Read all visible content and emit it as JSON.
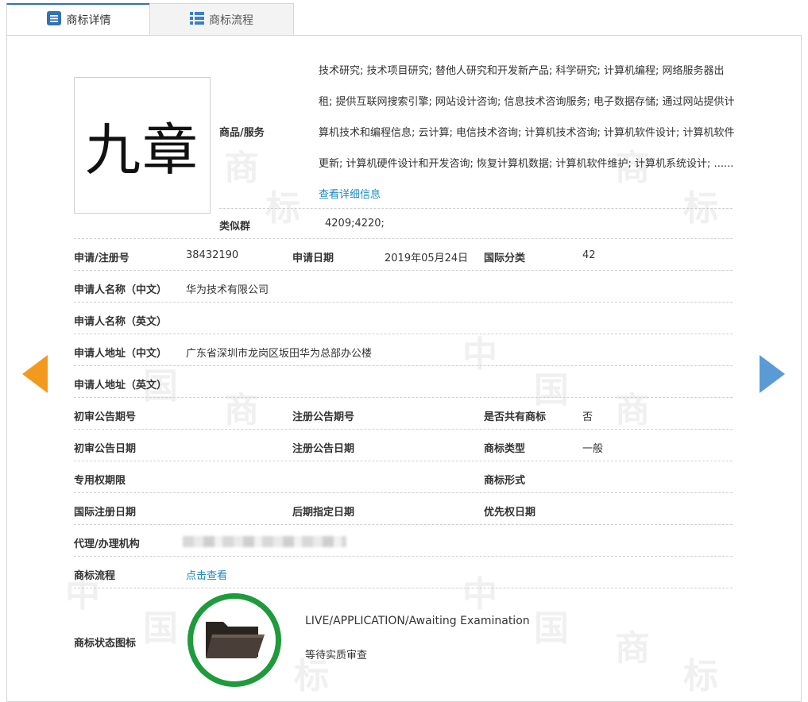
{
  "tabs": [
    {
      "label": "商标详情",
      "icon": "list-icon",
      "active": true
    },
    {
      "label": "商标流程",
      "icon": "grid-list-icon",
      "active": false
    }
  ],
  "trademark": {
    "logo_text": "九章",
    "goods_services_label": "商品/服务",
    "goods_services": "技术研究; 技术项目研究; 替他人研究和开发新产品; 科学研究; 计算机编程; 网络服务器出租; 提供互联网搜索引擎; 网站设计咨询; 信息技术咨询服务; 电子数据存储; 通过网站提供计算机技术和编程信息; 云计算; 电信技术咨询; 计算机技术咨询; 计算机软件设计; 计算机软件更新; 计算机硬件设计和开发咨询; 恢复计算机数据; 计算机软件维护; 计算机系统设计; ......",
    "more_link": "查看详细信息",
    "similar_group_label": "类似群",
    "similar_group": "4209;4220;"
  },
  "fields": {
    "reg_no_label": "申请/注册号",
    "reg_no": "38432190",
    "apply_date_label": "申请日期",
    "apply_date": "2019年05月24日",
    "intl_class_label": "国际分类",
    "intl_class": "42",
    "applicant_cn_label": "申请人名称（中文）",
    "applicant_cn": "华为技术有限公司",
    "applicant_en_label": "申请人名称（英文）",
    "address_cn_label": "申请人地址（中文）",
    "address_cn": "广东省深圳市龙岗区坂田华为总部办公楼",
    "address_en_label": "申请人地址（英文）",
    "prelim_no_label": "初审公告期号",
    "reg_pub_no_label": "注册公告期号",
    "shared_label": "是否共有商标",
    "shared": "否",
    "prelim_date_label": "初审公告日期",
    "reg_pub_date_label": "注册公告日期",
    "tm_type_label": "商标类型",
    "tm_type": "一般",
    "exclusive_term_label": "专用权期限",
    "tm_form_label": "商标形式",
    "intl_reg_date_label": "国际注册日期",
    "later_date_label": "后期指定日期",
    "priority_date_label": "优先权日期",
    "agent_label": "代理/办理机构",
    "flow_label": "商标流程",
    "flow_link": "点击查看",
    "status_icon_label": "商标状态图标",
    "status_en": "LIVE/APPLICATION/Awaiting Examination",
    "status_cn": "等待实质审查"
  },
  "watermark": [
    "中",
    "国",
    "商",
    "标"
  ],
  "colors": {
    "tab_accent": "#2f72b8",
    "link": "#1e88c7",
    "arrow_left": "#f39a1e",
    "arrow_right": "#5b9bd5",
    "status_ring": "#1f9a3c"
  }
}
